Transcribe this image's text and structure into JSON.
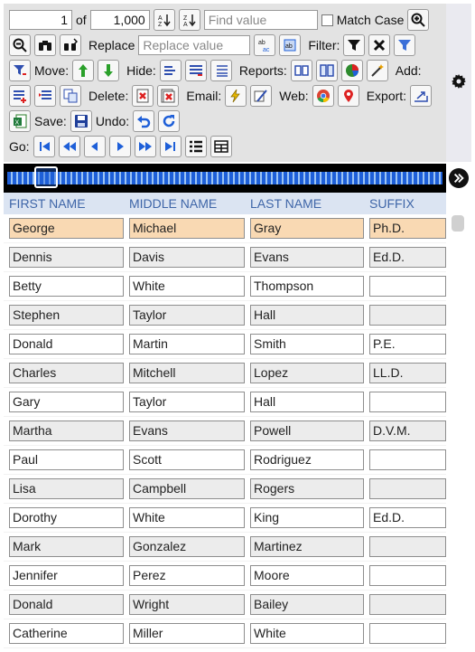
{
  "toolbar": {
    "record_number": "1",
    "of_label": "of",
    "record_total": "1,000",
    "find_placeholder": "Find value",
    "match_case_label": "Match Case",
    "replace_label": "Replace",
    "replace_placeholder": "Replace value",
    "filter_label": "Filter:",
    "move_label": "Move:",
    "hide_label": "Hide:",
    "reports_label": "Reports:",
    "add_label": "Add:",
    "delete_label": "Delete:",
    "email_label": "Email:",
    "web_label": "Web:",
    "export_label": "Export:",
    "save_label": "Save:",
    "undo_label": "Undo:",
    "go_label": "Go:"
  },
  "grid": {
    "columns": [
      "FIRST NAME",
      "MIDDLE NAME",
      "LAST NAME",
      "SUFFIX"
    ],
    "rows": [
      {
        "first": "George",
        "middle": "Michael",
        "last": "Gray",
        "suffix": "Ph.D.",
        "state": "selected"
      },
      {
        "first": "Dennis",
        "middle": "Davis",
        "last": "Evans",
        "suffix": "Ed.D.",
        "state": "odd"
      },
      {
        "first": "Betty",
        "middle": "White",
        "last": "Thompson",
        "suffix": "",
        "state": "even"
      },
      {
        "first": "Stephen",
        "middle": "Taylor",
        "last": "Hall",
        "suffix": "",
        "state": "odd"
      },
      {
        "first": "Donald",
        "middle": "Martin",
        "last": "Smith",
        "suffix": "P.E.",
        "state": "even"
      },
      {
        "first": "Charles",
        "middle": "Mitchell",
        "last": "Lopez",
        "suffix": "LL.D.",
        "state": "odd"
      },
      {
        "first": "Gary",
        "middle": "Taylor",
        "last": "Hall",
        "suffix": "",
        "state": "even"
      },
      {
        "first": "Martha",
        "middle": "Evans",
        "last": "Powell",
        "suffix": "D.V.M.",
        "state": "odd"
      },
      {
        "first": "Paul",
        "middle": "Scott",
        "last": "Rodriguez",
        "suffix": "",
        "state": "even"
      },
      {
        "first": "Lisa",
        "middle": "Campbell",
        "last": "Rogers",
        "suffix": "",
        "state": "odd"
      },
      {
        "first": "Dorothy",
        "middle": "White",
        "last": "King",
        "suffix": "Ed.D.",
        "state": "even"
      },
      {
        "first": "Mark",
        "middle": "Gonzalez",
        "last": "Martinez",
        "suffix": "",
        "state": "odd"
      },
      {
        "first": "Jennifer",
        "middle": "Perez",
        "last": "Moore",
        "suffix": "",
        "state": "even"
      },
      {
        "first": "Donald",
        "middle": "Wright",
        "last": "Bailey",
        "suffix": "",
        "state": "odd"
      },
      {
        "first": "Catherine",
        "middle": "Miller",
        "last": "White",
        "suffix": "",
        "state": "even"
      }
    ]
  },
  "colors": {
    "selected_row": "#f9d9b3",
    "header_text": "#3f66a8",
    "header_bg": "#dbe4f2",
    "nav_blue": "#1e5fd8"
  }
}
